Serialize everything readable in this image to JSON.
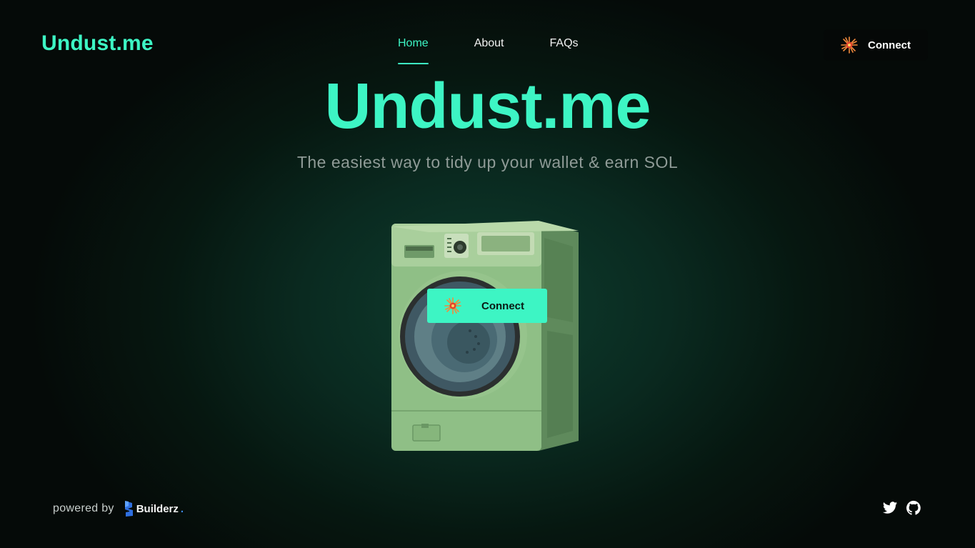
{
  "header": {
    "logo": "Undust.me",
    "nav": [
      {
        "label": "Home",
        "active": true
      },
      {
        "label": "About",
        "active": false
      },
      {
        "label": "FAQs",
        "active": false
      }
    ],
    "connect_label": "Connect"
  },
  "hero": {
    "title": "Undust.me",
    "subtitle": "The easiest way to tidy up your wallet & earn SOL",
    "connect_label": "Connect"
  },
  "footer": {
    "powered_by": "powered by",
    "brand": "Builderz",
    "brand_suffix": ".",
    "socials": [
      "twitter-icon",
      "github-icon"
    ]
  },
  "colors": {
    "accent": "#3df5c4",
    "background": "#050a08",
    "machine_green": "#8fbf86"
  },
  "icons": {
    "connect": "phantom-spark-icon",
    "illustration": "washing-machine"
  }
}
